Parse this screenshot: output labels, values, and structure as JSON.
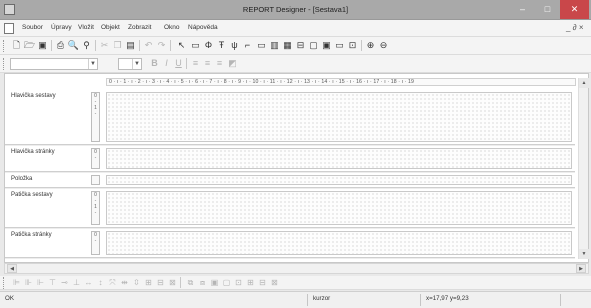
{
  "window": {
    "title": "REPORT Designer - [Sestava1]",
    "min_label": "–",
    "max_label": "□",
    "close_label": "✕"
  },
  "menu": {
    "items": [
      "Soubor",
      "Úpravy",
      "Vložit",
      "Objekt",
      "Zobrazit",
      "Okno",
      "Nápověda"
    ],
    "mdi_controls": "_ ∂ ×"
  },
  "toolbar": {
    "grip": ""
  },
  "ruler": {
    "text": "0 · ı · 1 · ı · 2 · ı · 3 · ı · 4 · ı · 5 · ı · 6 · ı · 7 · ı · 8 · ı · 9 · ı · 10 · ı · 11 · ı · 12 · ı · 13 · ı · 14 · ı · 15 · ı · 16 · ı · 17 · ı · 18 · ı · 19"
  },
  "sections": [
    {
      "label": "Hlavička sestavy",
      "vruler": "0 - 1 -"
    },
    {
      "label": "Hlavička stránky",
      "vruler": "0 -"
    },
    {
      "label": "Položka",
      "vruler": ""
    },
    {
      "label": "Patička sestavy",
      "vruler": "0 - 1 -"
    },
    {
      "label": "Patička stránky",
      "vruler": "0 -"
    }
  ],
  "status": {
    "left": "OK",
    "middle": "kurzor",
    "coords": "x=17,97   y=9,23"
  },
  "colors": {
    "titlebar": "#a9a9a9",
    "close_button": "#c9474a",
    "grid_dots": "#b9b9b9"
  }
}
